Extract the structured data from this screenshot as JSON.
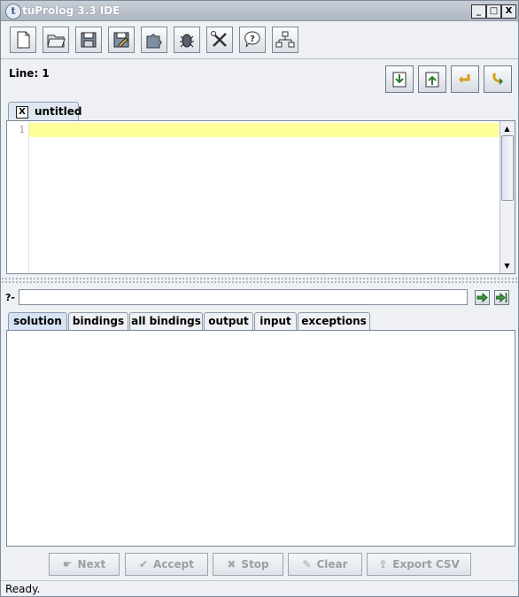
{
  "window": {
    "title": "tuProlog 3.3 IDE",
    "controls": [
      "_",
      "□",
      "X"
    ]
  },
  "toolbar": {
    "buttons": [
      {
        "name": "new-file-icon"
      },
      {
        "name": "open-folder-icon"
      },
      {
        "name": "save-icon"
      },
      {
        "name": "save-as-icon"
      },
      {
        "name": "library-puzzle-icon"
      },
      {
        "name": "debug-bug-icon"
      },
      {
        "name": "tools-icon"
      },
      {
        "name": "help-icon"
      },
      {
        "name": "tree-icon"
      }
    ]
  },
  "line": {
    "label": "Line: 1"
  },
  "editor": {
    "tab_close": "X",
    "tab_label": "untitled",
    "line_number": "1",
    "content": ""
  },
  "query": {
    "prompt": "?-",
    "value": ""
  },
  "result_tabs": [
    "solution",
    "bindings",
    "all bindings",
    "output",
    "input",
    "exceptions"
  ],
  "actions": {
    "next": "Next",
    "accept": "Accept",
    "stop": "Stop",
    "clear": "Clear",
    "export": "Export CSV"
  },
  "status": {
    "text": "Ready."
  },
  "colors": {
    "current_line": "#ffff99",
    "title_bar": "#aeb6c1",
    "active_tab": "#d7e3f3"
  }
}
